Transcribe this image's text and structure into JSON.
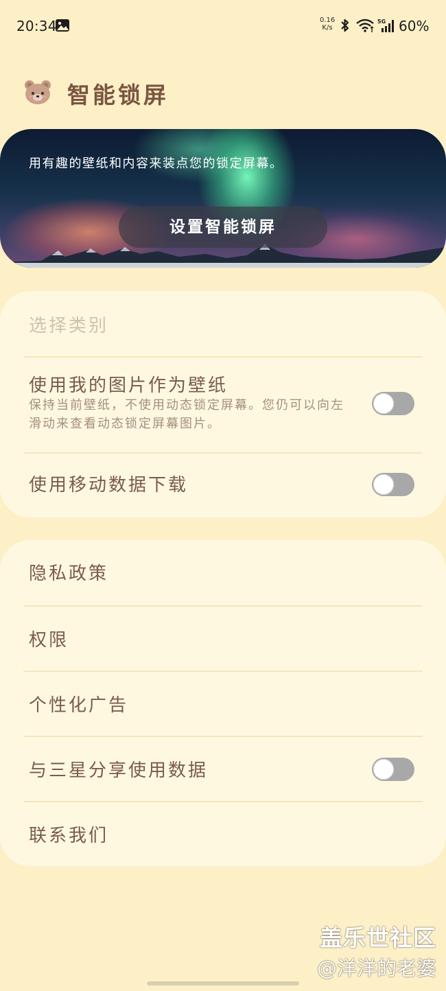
{
  "status_bar": {
    "time": "20:34",
    "net_speed": "0.16\nK/s",
    "battery": "60%",
    "icons": [
      "gallery-icon",
      "bluetooth-icon",
      "wifi-icon",
      "signal-5g-icon"
    ]
  },
  "header": {
    "icon": "bear-face-icon",
    "title": "智能锁屏"
  },
  "banner": {
    "description": "用有趣的壁纸和内容来装点您的锁定屏幕。",
    "button_label": "设置智能锁屏"
  },
  "settings_card": {
    "category_title": "选择类别",
    "use_my_pictures": {
      "title": "使用我的图片作为壁纸",
      "description": "保持当前壁纸，不使用动态锁定屏幕。您仍可以向左滑动来查看动态锁定屏幕图片。",
      "toggle_on": false
    },
    "mobile_data": {
      "title": "使用移动数据下载",
      "toggle_on": false
    }
  },
  "links_card": {
    "privacy": "隐私政策",
    "permissions": "权限",
    "personalized_ads": "个性化广告",
    "share_data": {
      "title": "与三星分享使用数据",
      "toggle_on": false
    },
    "contact": "联系我们"
  },
  "watermark": {
    "line1": "盖乐世社区",
    "line2": "@洋洋的老婆"
  },
  "colors": {
    "background": "#fdf0c7",
    "card": "#fff8e1",
    "text_primary": "#7a5c48",
    "toggle_off": "#a8a8a8"
  }
}
